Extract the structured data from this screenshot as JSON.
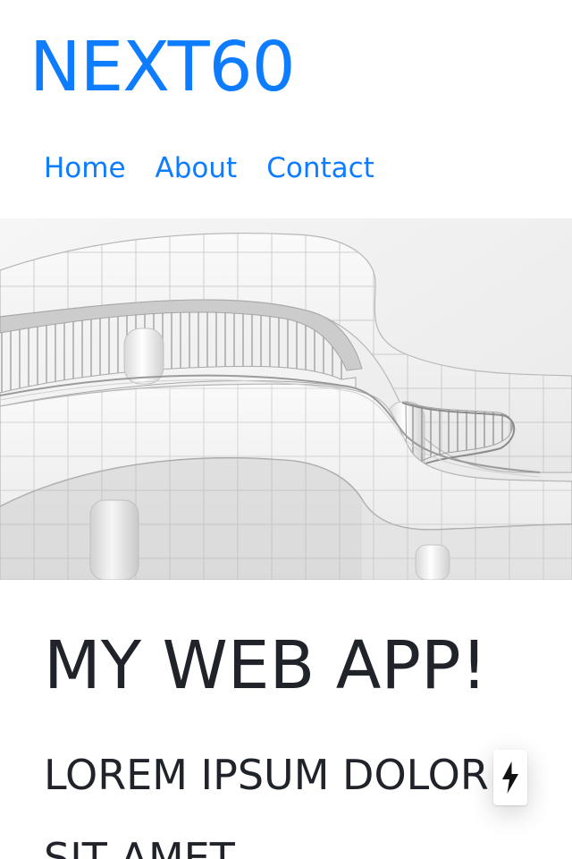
{
  "brand": {
    "name": "NEXT60",
    "color": "#0d7cff"
  },
  "nav": {
    "items": [
      {
        "label": "Home"
      },
      {
        "label": "About"
      },
      {
        "label": "Contact"
      }
    ]
  },
  "hero": {
    "image": "modern-white-building-image"
  },
  "main": {
    "heading": "MY WEB APP!",
    "subheading": "LOREM IPSUM DOLOR SIT AMET"
  },
  "floating_button": {
    "icon": "lightning-bolt-icon"
  },
  "colors": {
    "link": "#0d7cff",
    "text": "#202329",
    "background": "#ffffff"
  }
}
